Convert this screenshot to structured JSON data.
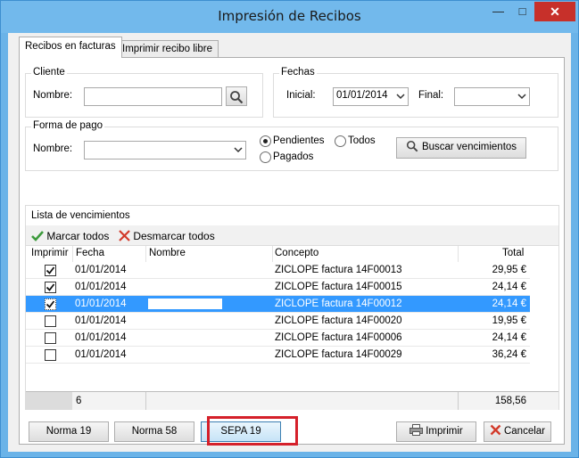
{
  "window": {
    "title": "Impresión de Recibos",
    "minimize_glyph": "—",
    "maximize_glyph": "□",
    "close_glyph": "✕"
  },
  "tabs": [
    {
      "label": "Recibos en facturas",
      "active": true
    },
    {
      "label": "Imprimir recibo libre",
      "active": false
    }
  ],
  "cliente": {
    "group_label": "Cliente",
    "nombre_label": "Nombre:",
    "nombre_value": ""
  },
  "fechas": {
    "group_label": "Fechas",
    "inicial_label": "Inicial:",
    "inicial_value": "01/01/2014",
    "final_label": "Final:",
    "final_value": ""
  },
  "forma_pago": {
    "group_label": "Forma de pago",
    "nombre_label": "Nombre:",
    "nombre_value": "",
    "radio_pendientes": "Pendientes",
    "radio_todos": "Todos",
    "radio_pagados": "Pagados",
    "selected": "Pendientes",
    "search_button": "Buscar vencimientos"
  },
  "lista": {
    "group_label": "Lista de vencimientos",
    "mark_all": "Marcar todos",
    "unmark_all": "Desmarcar todos",
    "columns": {
      "imprimir": "Imprimir",
      "fecha": "Fecha",
      "nombre": "Nombre",
      "concepto": "Concepto",
      "total": "Total"
    },
    "rows": [
      {
        "checked": true,
        "fecha": "01/01/2014",
        "nombre": "",
        "concepto": "ZICLOPE factura 14F00013",
        "total": "29,95 €",
        "selected": false
      },
      {
        "checked": true,
        "fecha": "01/01/2014",
        "nombre": "",
        "concepto": "ZICLOPE factura 14F00015",
        "total": "24,14 €",
        "selected": false
      },
      {
        "checked": true,
        "fecha": "01/01/2014",
        "nombre": "",
        "concepto": "ZICLOPE factura 14F00012",
        "total": "24,14 €",
        "selected": true
      },
      {
        "checked": false,
        "fecha": "01/01/2014",
        "nombre": "",
        "concepto": "ZICLOPE factura 14F00020",
        "total": "19,95 €",
        "selected": false
      },
      {
        "checked": false,
        "fecha": "01/01/2014",
        "nombre": "",
        "concepto": "ZICLOPE factura 14F00006",
        "total": "24,14 €",
        "selected": false
      },
      {
        "checked": false,
        "fecha": "01/01/2014",
        "nombre": "",
        "concepto": "ZICLOPE factura 14F00029",
        "total": "36,24 €",
        "selected": false
      }
    ],
    "footer": {
      "count": "6",
      "sum": "158,56"
    }
  },
  "buttons": {
    "norma19": "Norma 19",
    "norma58": "Norma 58",
    "sepa19": "SEPA 19",
    "imprimir": "Imprimir",
    "cancelar": "Cancelar"
  },
  "icons": {
    "search": "magnifier-icon",
    "check": "green-check-icon",
    "cross": "red-cross-icon",
    "printer": "printer-icon",
    "cancel": "red-x-icon"
  },
  "colors": {
    "titlebar": "#72b9ec",
    "close": "#c7302a",
    "selection": "#3399ff",
    "highlight_frame": "#d5202a"
  }
}
